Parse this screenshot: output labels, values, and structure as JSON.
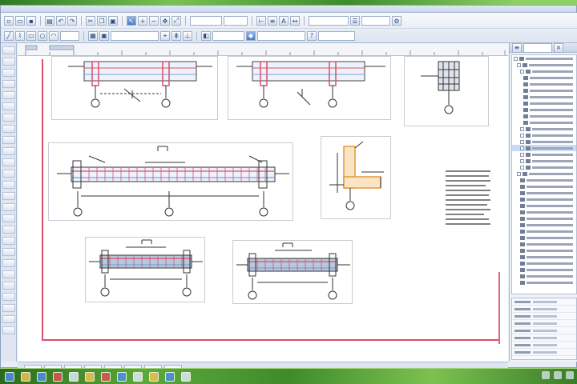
{
  "window": {
    "title": ""
  },
  "toolbar": {
    "row1_buttons": [
      "new",
      "open",
      "save",
      "print",
      "undo",
      "redo",
      "cut",
      "copy",
      "paste",
      "select",
      "zoom-in",
      "zoom-out",
      "pan",
      "fit",
      "measure",
      "layer",
      "text",
      "dimension"
    ],
    "row2_buttons": [
      "line",
      "polyline",
      "rect",
      "circle",
      "arc",
      "hatch",
      "block",
      "snap",
      "grid",
      "ortho"
    ]
  },
  "drawing": {
    "details": [
      {
        "id": "detail-1",
        "label": ""
      },
      {
        "id": "detail-2",
        "label": ""
      },
      {
        "id": "detail-3",
        "label": ""
      },
      {
        "id": "detail-4",
        "label": ""
      },
      {
        "id": "detail-5",
        "label": ""
      },
      {
        "id": "detail-6",
        "label": ""
      },
      {
        "id": "detail-7",
        "label": ""
      }
    ],
    "colors": {
      "sheet_border": "#d9506a",
      "rebar": "#d9506a",
      "concrete_fill": "#b9c7dd",
      "steel": "#e29a3a",
      "lines": "#3a3a3a"
    }
  },
  "right_panel": {
    "tree_rows": 36,
    "property_rows": 8
  },
  "status_tabs": 8,
  "taskbar": {
    "icons": [
      "start",
      "explorer",
      "browser",
      "media",
      "office",
      "cad",
      "pdf",
      "chat",
      "mail",
      "tool",
      "cad2",
      "app"
    ]
  }
}
